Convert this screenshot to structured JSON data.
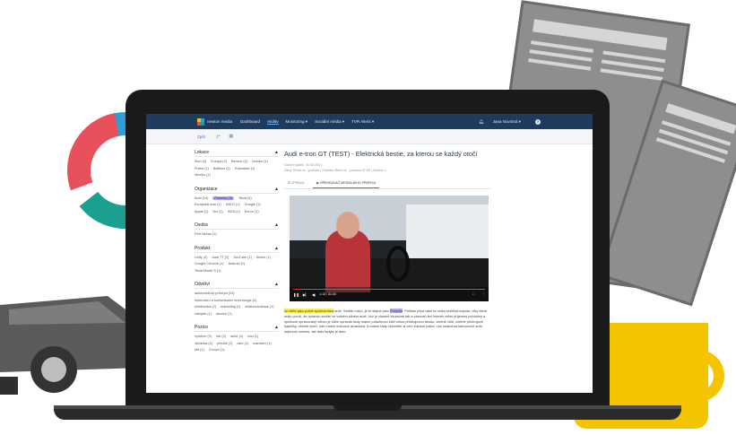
{
  "app": {
    "logo_text": "newton media",
    "nav": [
      "Dashboard",
      "Archiv",
      "Monitoring ▾",
      "Sociální média ▾",
      "TVR Alerts ▾"
    ],
    "nav_active_index": 1,
    "user_name": "Jana Novotná ▾",
    "help_label": "?",
    "colors": {
      "navbar": "#1e3a5c",
      "accent": "#3a7bd5",
      "highlight_yellow": "#f7ef4a",
      "highlight_purple": "#b7a8f0"
    }
  },
  "toolbar": {
    "back_label": "Zpět",
    "download_icon": "download-icon",
    "calendar_icon": "calendar-icon"
  },
  "sidebar": {
    "sections": [
      {
        "title": "Lokace",
        "toggle": "▲",
        "tags": [
          "Sion (3)",
          "Evropa (2)",
          "Beroun (2)",
          "Norsko (1)",
          "Praha (1)",
          "Baltikus (1)",
          "Rotvaldov (1)",
          "Mexiko (1)"
        ]
      },
      {
        "title": "Organizace",
        "toggle": "▲",
        "tags": [
          "Audi (24)",
          "Porsche (3)",
          "Tesla (2)",
          "Evropská unie (1)",
          "NATO (1)",
          "Google (1)",
          "Apple (1)",
          "Nvi (1)",
          "IKEA (1)",
          "Enron (1)"
        ],
        "selected_index": 1
      },
      {
        "title": "Osoba",
        "toggle": "▲",
        "tags": [
          "Petr Nečas (1)"
        ]
      },
      {
        "title": "Produkt",
        "toggle": "▲",
        "tags": [
          "Unity (2)",
          "Audi TT (2)",
          "YouTube (1)",
          "Kinkin (1)",
          "Google Chrome (1)",
          "Android (1)",
          "Tesla Model S (1)"
        ]
      },
      {
        "title": "Odvětví",
        "toggle": "▲",
        "tags": [
          "automobilový průmysl (24)",
          "informační a komunikační technologie (2)",
          "elektronika (2)",
          "marketing (1)",
          "telekomunikace (1)",
          "nábytek (1)",
          "alkohol (1)"
        ]
      },
      {
        "title": "Pozice",
        "toggle": "▲",
        "tags": [
          "výrobce (9)",
          "lídr (2)",
          "autor (1)",
          "kód (1)",
          "občanka (1)",
          "předák (1)",
          "otec (1)",
          "manažer (1)",
          "šéf (1)",
          "Chcípn (1)"
        ]
      }
    ]
  },
  "article": {
    "title": "Audi e-tron GT (TEST) - Elektrická bestie, za kterou se každý otočí",
    "meta_line1": "Datum vydání: 30.05.2021",
    "meta_line2": "Zdroj: filmm.cz - youtube  |  Rubrika: filmm.cz - youtube 07:30  |  Zpráva: 1",
    "tabs": [
      "ZPRÁVA",
      "PŘEHRÁVAČ MEDIÁLNÍHO PŘEPISU"
    ],
    "active_tab_index": 1,
    "video": {
      "time": "1:13 / 31:30",
      "progress": 0.04
    },
    "transcript": {
      "hl1": "se cítíte jako právě sportovníma",
      "t1": " auto. Sedíte nízko, je to stejné jako ",
      "hl2": "Porsche",
      "t2": ". Pelikán před vámi ta velká rozlehlá kapota, díky které málo pocítí, že opravdu sedíte ve velkém silném autě, což je vlastně skutečně tak a zároveň ten interiér velmi příjemný pohodlný a špičkově zpracovaný vůbec je kůže opravdu tady máme potaženou kůží celou přístrojovou desku, včetně vůle, včetně přístrojové kapličky, včetně dveří, kde máme dokonce alcantara. A máme tady všimněte si celo Karbon paket, což znamená karbonové auto nejenom zvenku, ale dalo tadyto je auto"
    }
  }
}
